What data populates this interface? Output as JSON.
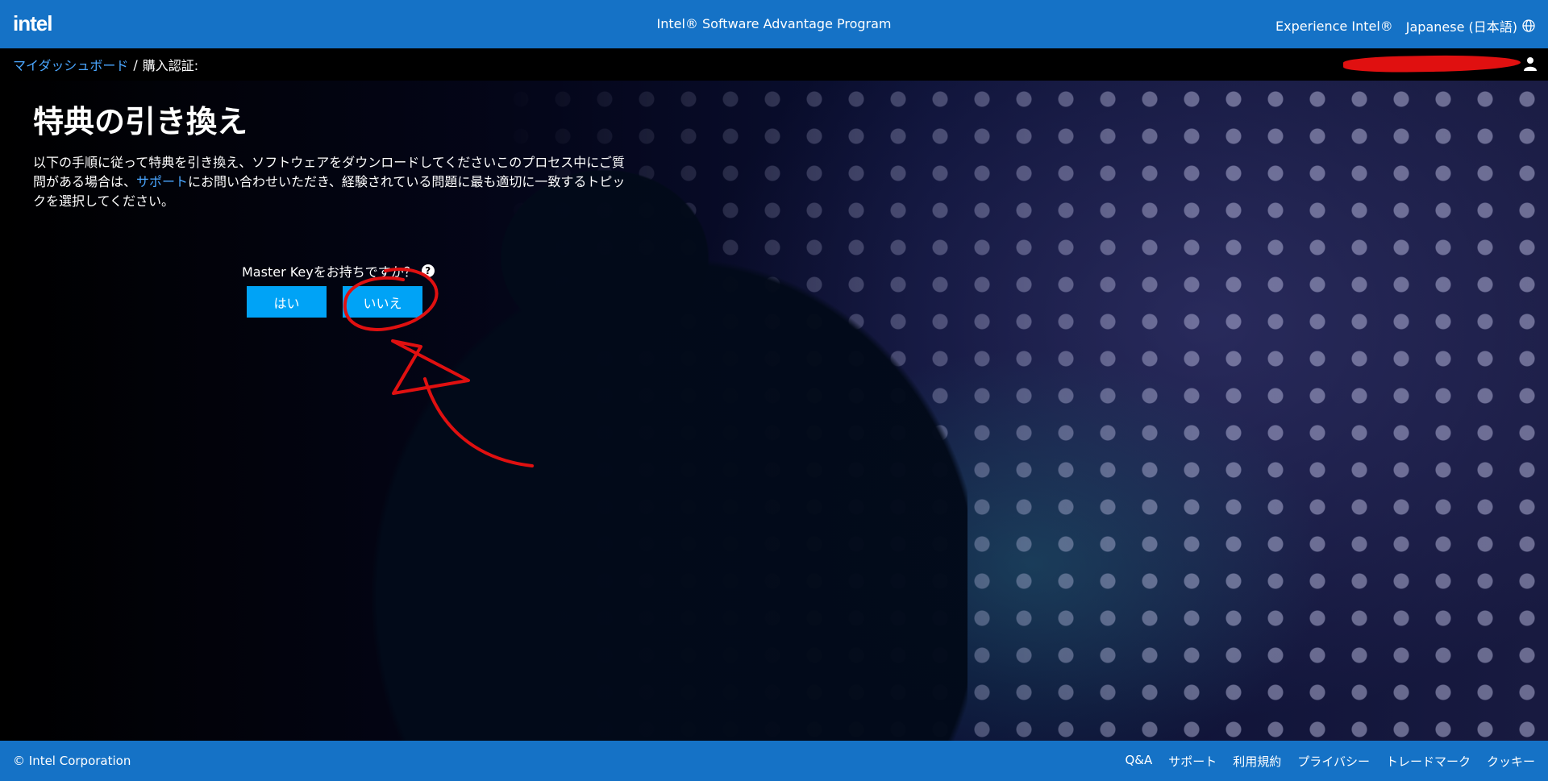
{
  "header": {
    "logo": "intel",
    "title": "Intel® Software Advantage Program",
    "experience_link": "Experience Intel®",
    "language": "Japanese (日本語)"
  },
  "breadcrumb": {
    "dashboard": "マイダッシュボード",
    "separator": "/",
    "current": "購入認証:"
  },
  "main": {
    "title": "特典の引き換え",
    "desc_before": "以下の手順に従って特典を引き換え、ソフトウェアをダウンロードしてくださいこのプロセス中にご質問がある場合は、",
    "desc_link": "サポート",
    "desc_after": "にお問い合わせいただき、経験されている問題に最も適切に一致するトピックを選択してください。",
    "master_key_question": "Master Keyをお持ちですか？",
    "help_symbol": "?",
    "yes_button": "はい",
    "no_button": "いいえ"
  },
  "footer": {
    "copyright": "© Intel Corporation",
    "links": [
      "Q&A",
      "サポート",
      "利用規約",
      "プライバシー",
      "トレードマーク",
      "クッキー"
    ]
  },
  "colors": {
    "brand_blue": "#1572c6",
    "button_blue": "#00a3f6",
    "link_blue": "#4aa6ff",
    "annotation_red": "#e01010"
  }
}
